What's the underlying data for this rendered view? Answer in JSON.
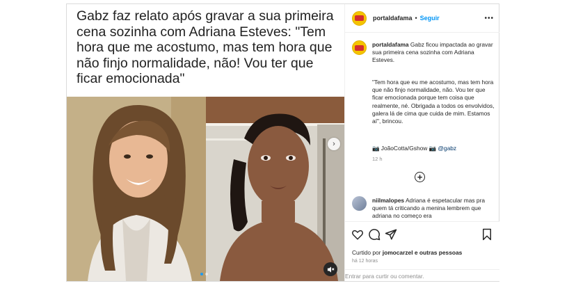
{
  "media": {
    "headline": "Gabz faz relato após gravar a sua primeira cena sozinha com Adriana Esteves: \"Tem hora que me acostumo, mas tem hora que não finjo normalidade, não! Vou ter que ficar emocionada\"",
    "next_icon": "chevron-right-icon",
    "audio_icon": "speaker-muted-icon",
    "carousel_pages": 2,
    "carousel_active": 1
  },
  "header": {
    "username": "portaldafama",
    "separator": "•",
    "follow_label": "Seguir",
    "more_label": "•••"
  },
  "caption": {
    "username": "portaldafama",
    "text": "Gabz ficou impactada ao gravar sua primeira cena sozinha com Adriana Esteves.",
    "quote": "\"Tem hora que eu me acostumo, mas tem hora que não finjo normalidade, não. Vou ter que ficar emocionada porque tem coisa que realmente, né. Obrigada a todos os envolvidos, galera lá de cima que cuida de mim. Estamos aí\", brincou.",
    "credit_prefix": "📷 JoãoCotta/Gshow 📷",
    "credit_mention": "@gabz",
    "time": "12 h"
  },
  "load_more_icon": "plus-circle-icon",
  "comment": {
    "username": "niilmalopes",
    "text": "Adriana é espetacular mas pra quem tá criticando a menina lembrem que adriana no começo era"
  },
  "actions": {
    "like_icon": "heart-icon",
    "comment_icon": "comment-bubble-icon",
    "share_icon": "paper-plane-icon",
    "save_icon": "bookmark-icon",
    "liked_prefix": "Curtido por",
    "liked_user": "jomocarzel",
    "liked_suffix": "e outras pessoas",
    "post_time": "há 12 horas"
  },
  "comment_input": {
    "placeholder": "Entrar para curtir ou comentar."
  },
  "colors": {
    "accent": "#0095f6",
    "muted": "#8e8e8e",
    "border": "#dbdbdb",
    "avatar_yellow": "#f5c400"
  }
}
